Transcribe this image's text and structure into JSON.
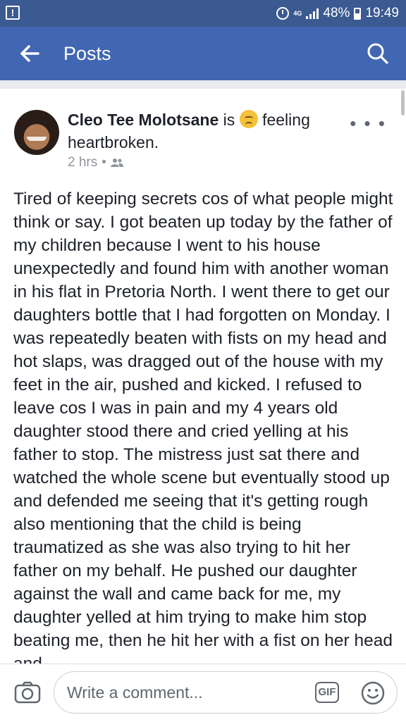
{
  "status_bar": {
    "network": "4G",
    "battery": "48%",
    "time": "19:49",
    "icons": [
      "notification-icon",
      "alarm-icon",
      "signal-icon",
      "battery-icon"
    ]
  },
  "app_bar": {
    "title": "Posts",
    "icons": [
      "back-arrow-icon",
      "search-icon"
    ],
    "color": "#4267b2"
  },
  "post": {
    "author": "Cleo Tee Molotsane",
    "is_text": "is",
    "feeling_prefix": "feeling",
    "feeling": "heartbroken.",
    "time": "2 hrs",
    "separator": "•",
    "privacy_icon": "friends-icon",
    "more_label": "• • •",
    "body": "Tired of keeping secrets cos of what people might think or say. I got beaten up today by the father of my children because I went to his house unexpectedly and found him with another woman in his flat in Pretoria North. I went there to get our daughters bottle that I had forgotten on Monday. I was repeatedly beaten with fists on my head and hot slaps, was dragged out of the house with my feet in the air, pushed and kicked. I refused to leave cos I was in pain and my 4 years old daughter stood there and cried yelling at his father to stop. The mistress just sat there and watched the whole scene but eventually stood up and defended me seeing that it's getting rough also mentioning that the child is being traumatized as she was also trying to hit her father on my behalf. He pushed our daughter against the wall and came back for me, my daughter yelled at him trying to make him stop beating me, then he hit her with a fist on her head and"
  },
  "comment_bar": {
    "placeholder": "Write a comment...",
    "gif_label": "GIF",
    "icons": [
      "camera-icon",
      "gif-icon",
      "emoji-icon"
    ]
  }
}
